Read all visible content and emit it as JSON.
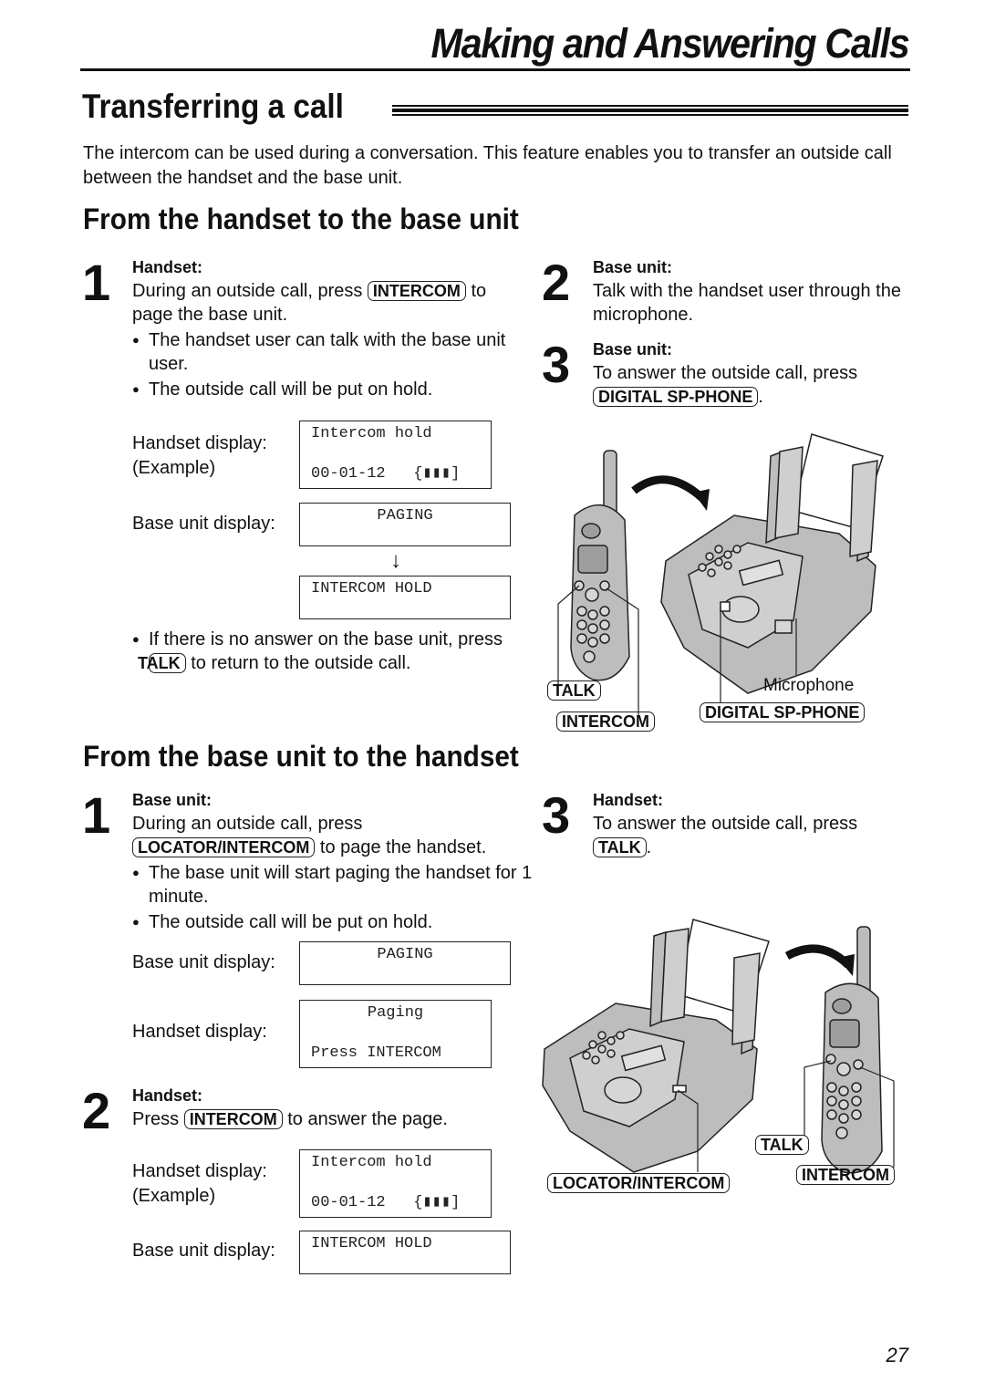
{
  "chapter_title": "Making and Answering Calls",
  "section_title": "Transferring a call",
  "intro": "The intercom can be used during a conversation. This feature enables you to transfer an outside call between the handset and the base unit.",
  "part1": {
    "title": "From the handset to the base unit",
    "steps": [
      {
        "number": "1",
        "heading": "Handset:",
        "text_before": "During an outside call, press",
        "key": "INTERCOM",
        "text_after": "to page the base unit.",
        "bullets": [
          "The handset user can talk with the base unit user.",
          "The outside call will be put on hold."
        ],
        "displays": {
          "handset_label": "Handset display:",
          "handset_example": "(Example)",
          "handset_line1": "Intercom hold",
          "handset_line2": "00-01-12",
          "base_label": "Base unit display:",
          "base_first": "PAGING",
          "base_second": "INTERCOM HOLD"
        },
        "note_before": "If there is no answer on the base unit, press",
        "note_key": "TALK",
        "note_after": "to return to the outside call."
      },
      {
        "number": "2",
        "heading": "Base unit:",
        "text": "Talk with the handset user through the microphone."
      },
      {
        "number": "3",
        "heading": "Base unit:",
        "text": "To answer the outside call, press",
        "key": "DIGITAL SP-PHONE",
        "text_after": "."
      }
    ],
    "figure": {
      "labels": {
        "talk": "TALK",
        "intercom": "INTERCOM",
        "microphone": "Microphone",
        "digital_sp_phone": "DIGITAL SP-PHONE"
      }
    }
  },
  "part2": {
    "title": "From the base unit to the handset",
    "steps": [
      {
        "number": "1",
        "heading": "Base unit:",
        "text_before": "During an outside call, press",
        "key": "LOCATOR/INTERCOM",
        "text_after": "to page the handset.",
        "bullets": [
          "The base unit will start paging the handset for 1 minute.",
          "The outside call will be put on hold."
        ],
        "displays": {
          "base_label": "Base unit display:",
          "base_text": "PAGING",
          "handset_label": "Handset display:",
          "handset_line1": "Paging",
          "handset_line2": "Press INTERCOM"
        }
      },
      {
        "number": "2",
        "heading": "Handset:",
        "text_before": "Press",
        "key": "INTERCOM",
        "text_after": "to answer the page.",
        "displays": {
          "handset_label": "Handset display:",
          "handset_example": "(Example)",
          "handset_line1": "Intercom hold",
          "handset_line2": "00-01-12",
          "base_label": "Base unit display:",
          "base_text": "INTERCOM HOLD"
        }
      },
      {
        "number": "3",
        "heading": "Handset:",
        "text": "To answer the outside call, press",
        "key": "TALK",
        "text_after": "."
      }
    ],
    "figure": {
      "labels": {
        "talk": "TALK",
        "intercom": "INTERCOM",
        "locator_intercom": "LOCATOR/INTERCOM"
      }
    }
  },
  "page_number": "27"
}
